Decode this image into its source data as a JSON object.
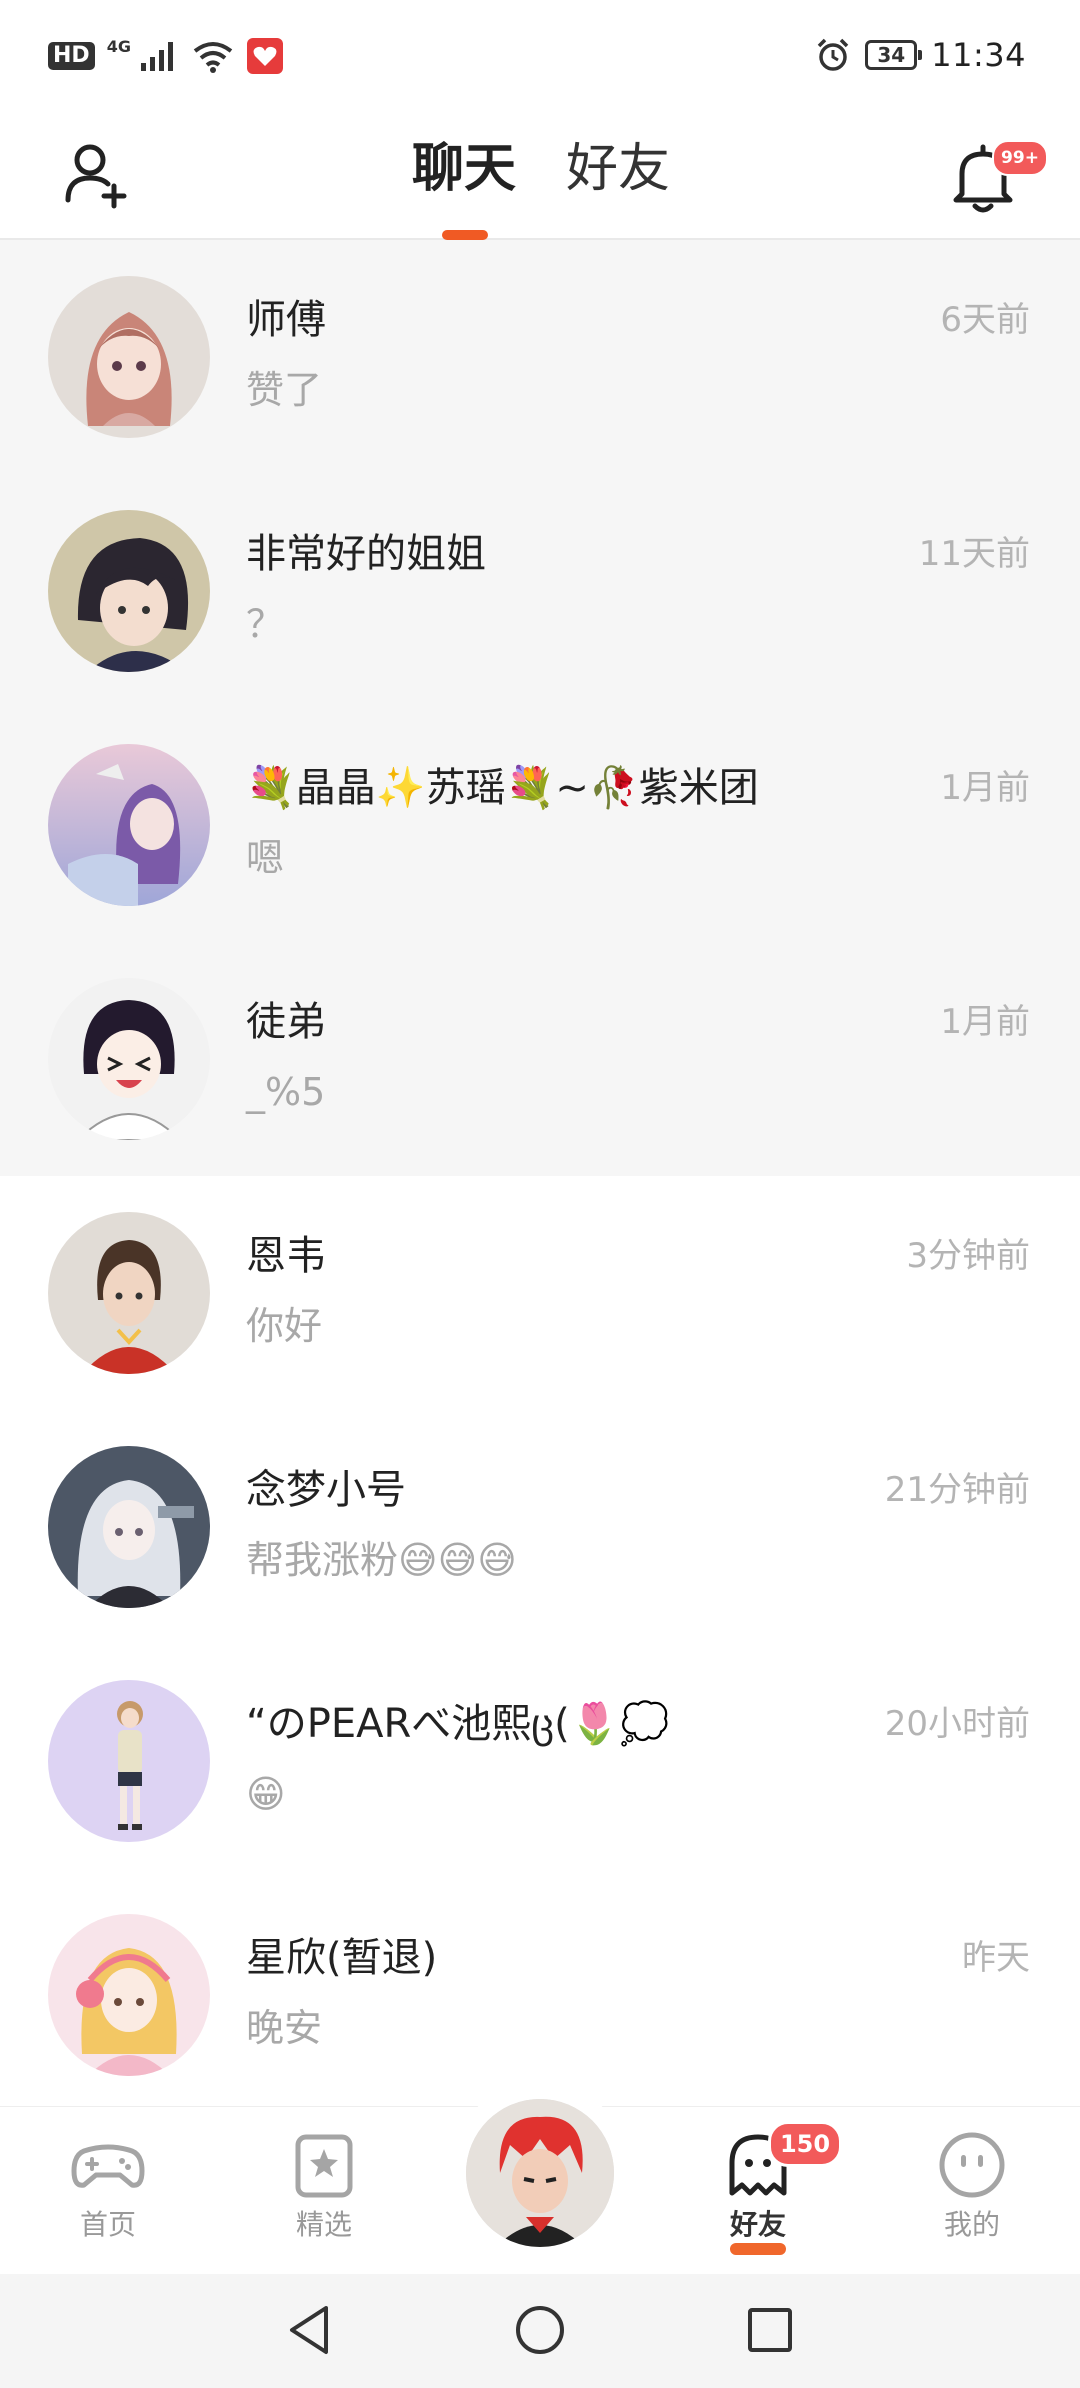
{
  "status_bar": {
    "hd": "HD",
    "network": "4G",
    "battery": "34",
    "time": "11:34"
  },
  "header": {
    "tabs": [
      {
        "label": "聊天",
        "active": true
      },
      {
        "label": "好友",
        "active": false
      }
    ],
    "notification_badge": "99+",
    "accent_color": "#f05a24"
  },
  "chats": [
    {
      "name": "师傅",
      "message": "赞了",
      "time": "6天前",
      "pinned": true,
      "avatar": "pink-hair-girl"
    },
    {
      "name": "非常好的姐姐",
      "message": "？",
      "time": "11天前",
      "pinned": true,
      "avatar": "dark-hair-boy"
    },
    {
      "name": "💐晶晶✨苏瑶💐~🥀紫米团",
      "message": "嗯",
      "time": "1月前",
      "pinned": true,
      "avatar": "purple-sky-girl"
    },
    {
      "name": "徒弟",
      "message": "_%5",
      "time": "1月前",
      "pinned": true,
      "avatar": "laughing-boy"
    },
    {
      "name": "恩韦",
      "message": "你好",
      "time": "3分钟前",
      "pinned": false,
      "avatar": "red-coat-man"
    },
    {
      "name": "念梦小号",
      "message": "帮我涨粉😅😅😅",
      "time": "21分钟前",
      "pinned": false,
      "avatar": "white-hair-girl"
    },
    {
      "name": "“のPEARべ池熙ც(🌷💭",
      "message": "😁",
      "time": "20小时前",
      "pinned": false,
      "avatar": "standing-girl"
    },
    {
      "name": "星欣(暂退)",
      "message": "晚安",
      "time": "昨天",
      "pinned": false,
      "avatar": "headphone-girl"
    }
  ],
  "bottom_nav": {
    "items": [
      {
        "label": "首页",
        "icon": "gamepad-icon"
      },
      {
        "label": "精选",
        "icon": "star-bookmark-icon"
      },
      {
        "label": "好友",
        "icon": "ghost-icon",
        "active": true,
        "badge": "150"
      },
      {
        "label": "我的",
        "icon": "smiley-icon"
      }
    ]
  }
}
